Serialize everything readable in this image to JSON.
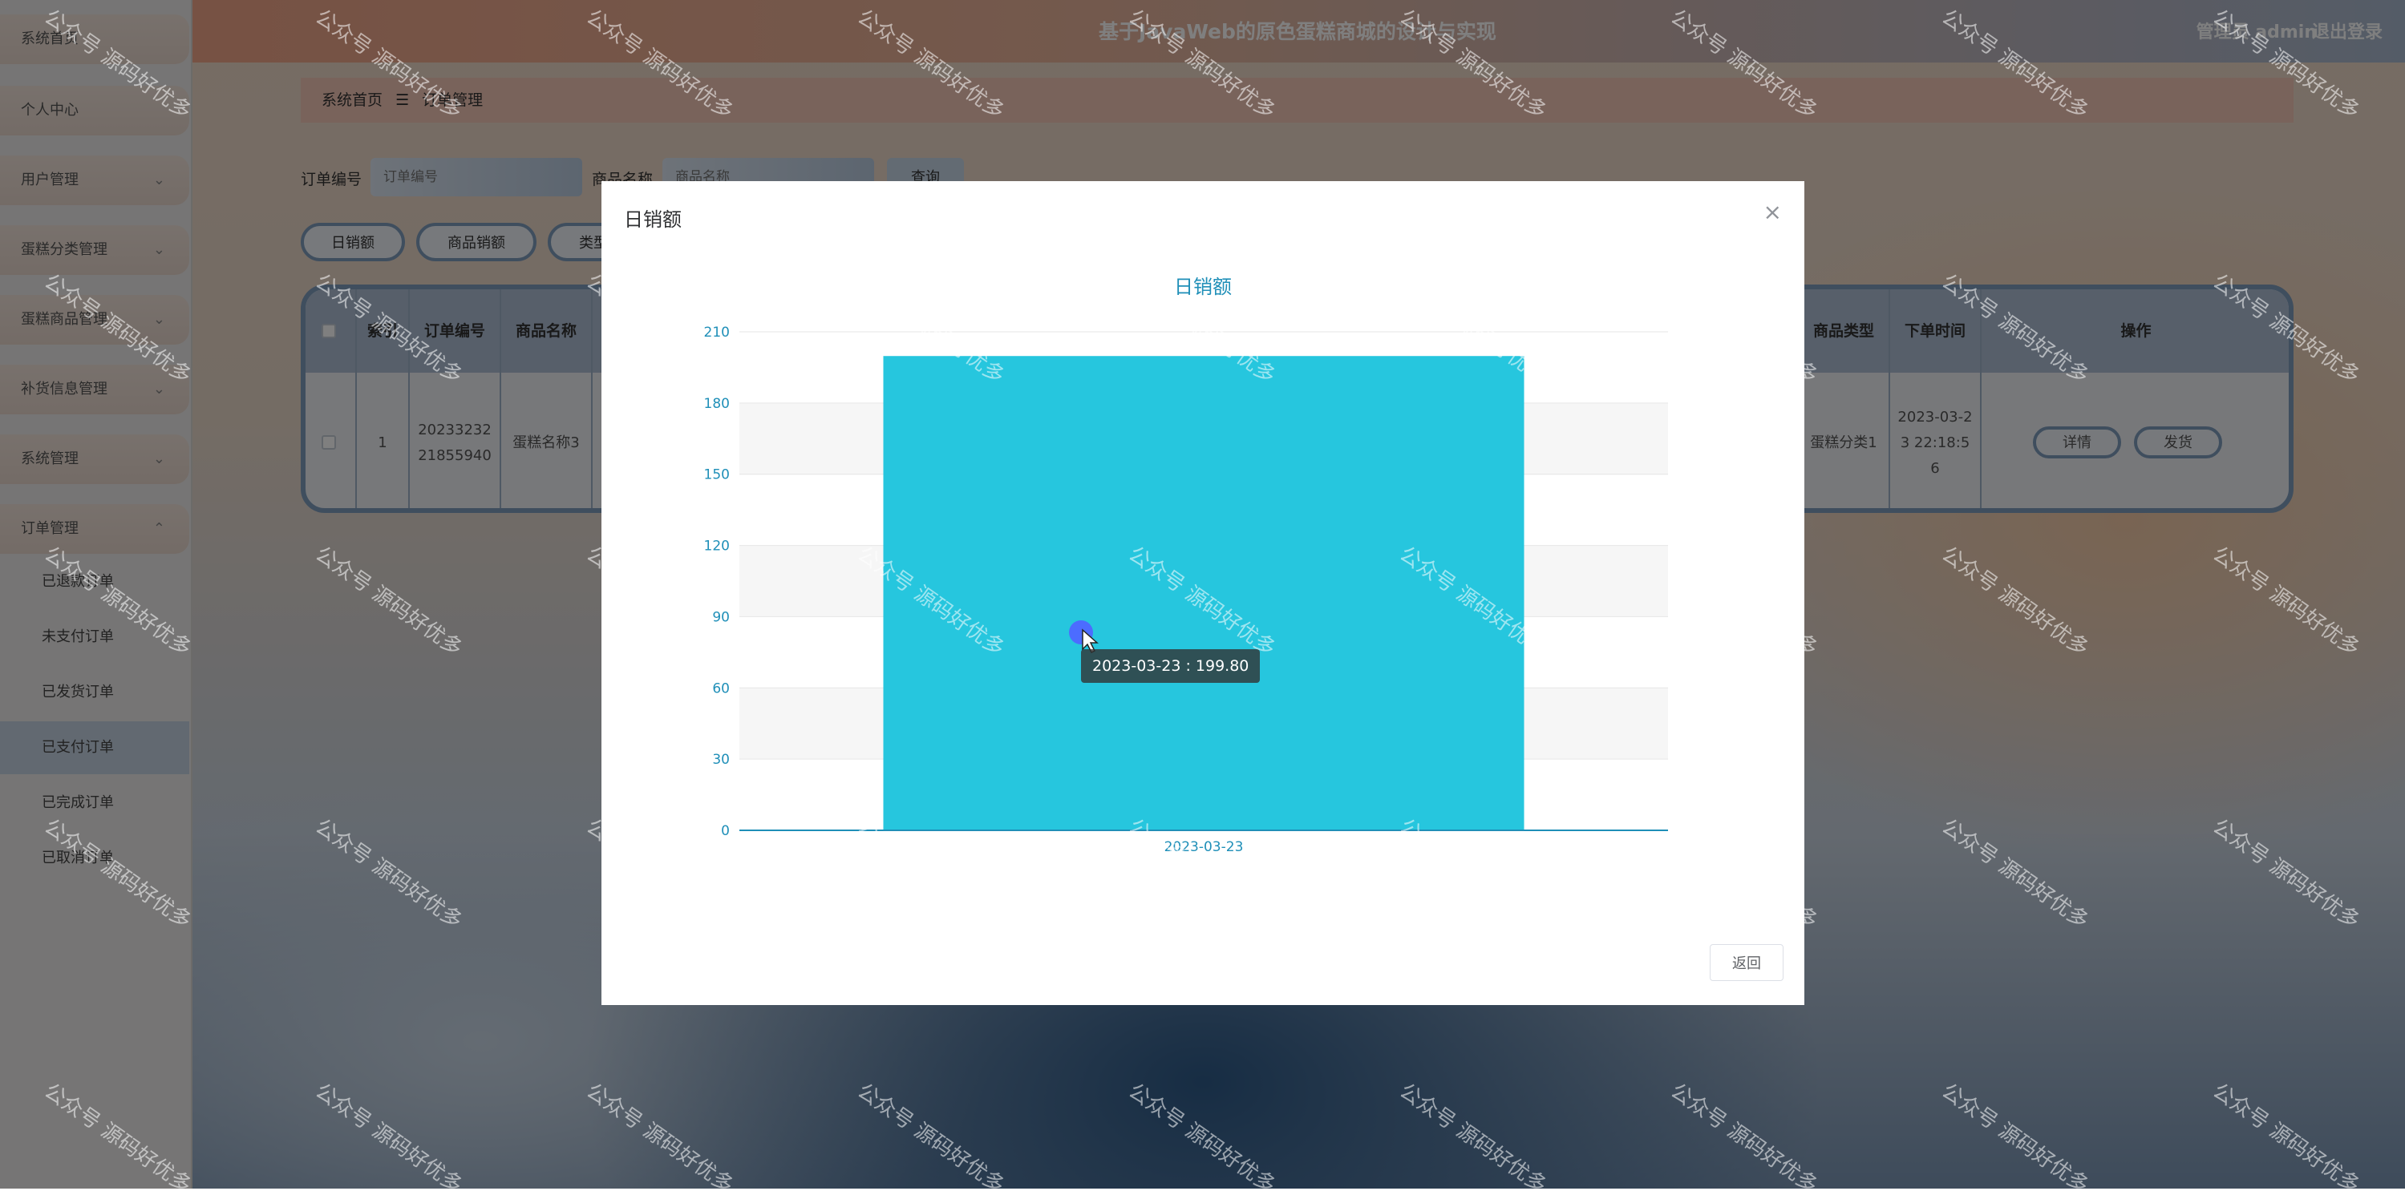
{
  "header": {
    "title": "基于JavaWeb的原色蛋糕商城的设计与实现",
    "user": "管理员 admin",
    "logout": "退出登录"
  },
  "sidebar": {
    "items": [
      {
        "label": "系统首页",
        "arrow": false
      },
      {
        "label": "个人中心",
        "arrow": false
      },
      {
        "label": "用户管理",
        "arrow": true
      },
      {
        "label": "蛋糕分类管理",
        "arrow": true
      },
      {
        "label": "蛋糕商品管理",
        "arrow": true
      },
      {
        "label": "补货信息管理",
        "arrow": true
      },
      {
        "label": "系统管理",
        "arrow": true
      },
      {
        "label": "订单管理",
        "arrow": true
      }
    ],
    "sub_items": [
      "已退款订单",
      "未支付订单",
      "已发货订单",
      "已支付订单",
      "已完成订单",
      "已取消订单"
    ],
    "active_sub": "已支付订单",
    "arrow_down": "⌄",
    "arrow_up": "⌃"
  },
  "breadcrumb": {
    "home": "系统首页",
    "separator": "☰",
    "current": "订单管理"
  },
  "search": {
    "order_no_label": "订单编号",
    "order_no_placeholder": "订单编号",
    "product_label": "商品名称",
    "product_placeholder": "商品名称",
    "query_button": "查询"
  },
  "stat_buttons": [
    "日销额",
    "商品销额",
    "类型销额"
  ],
  "table": {
    "headers": [
      "索引",
      "订单编号",
      "商品名称",
      "商品类型",
      "下单时间",
      "操作"
    ],
    "row": {
      "index": "1",
      "order_no": "2023323221855940",
      "product_name": "蛋糕名称3",
      "product_type": "蛋糕分类1",
      "order_time": "2023-03-23 22:18:56",
      "detail_button": "详情",
      "ship_button": "发货"
    }
  },
  "modal": {
    "title": "日销额",
    "close": "×",
    "back_button": "返回",
    "tooltip": "2023-03-23 : 199.80"
  },
  "chart_data": {
    "type": "bar",
    "title": "日销额",
    "categories": [
      "2023-03-23"
    ],
    "values": [
      199.8
    ],
    "ylim": [
      0,
      210
    ],
    "yticks": [
      0,
      30,
      60,
      90,
      120,
      150,
      180,
      210
    ],
    "grid": true,
    "bar_color": "#26c6de",
    "axis_color": "#1f8fb8"
  },
  "watermark": "公众号 源码好优多"
}
